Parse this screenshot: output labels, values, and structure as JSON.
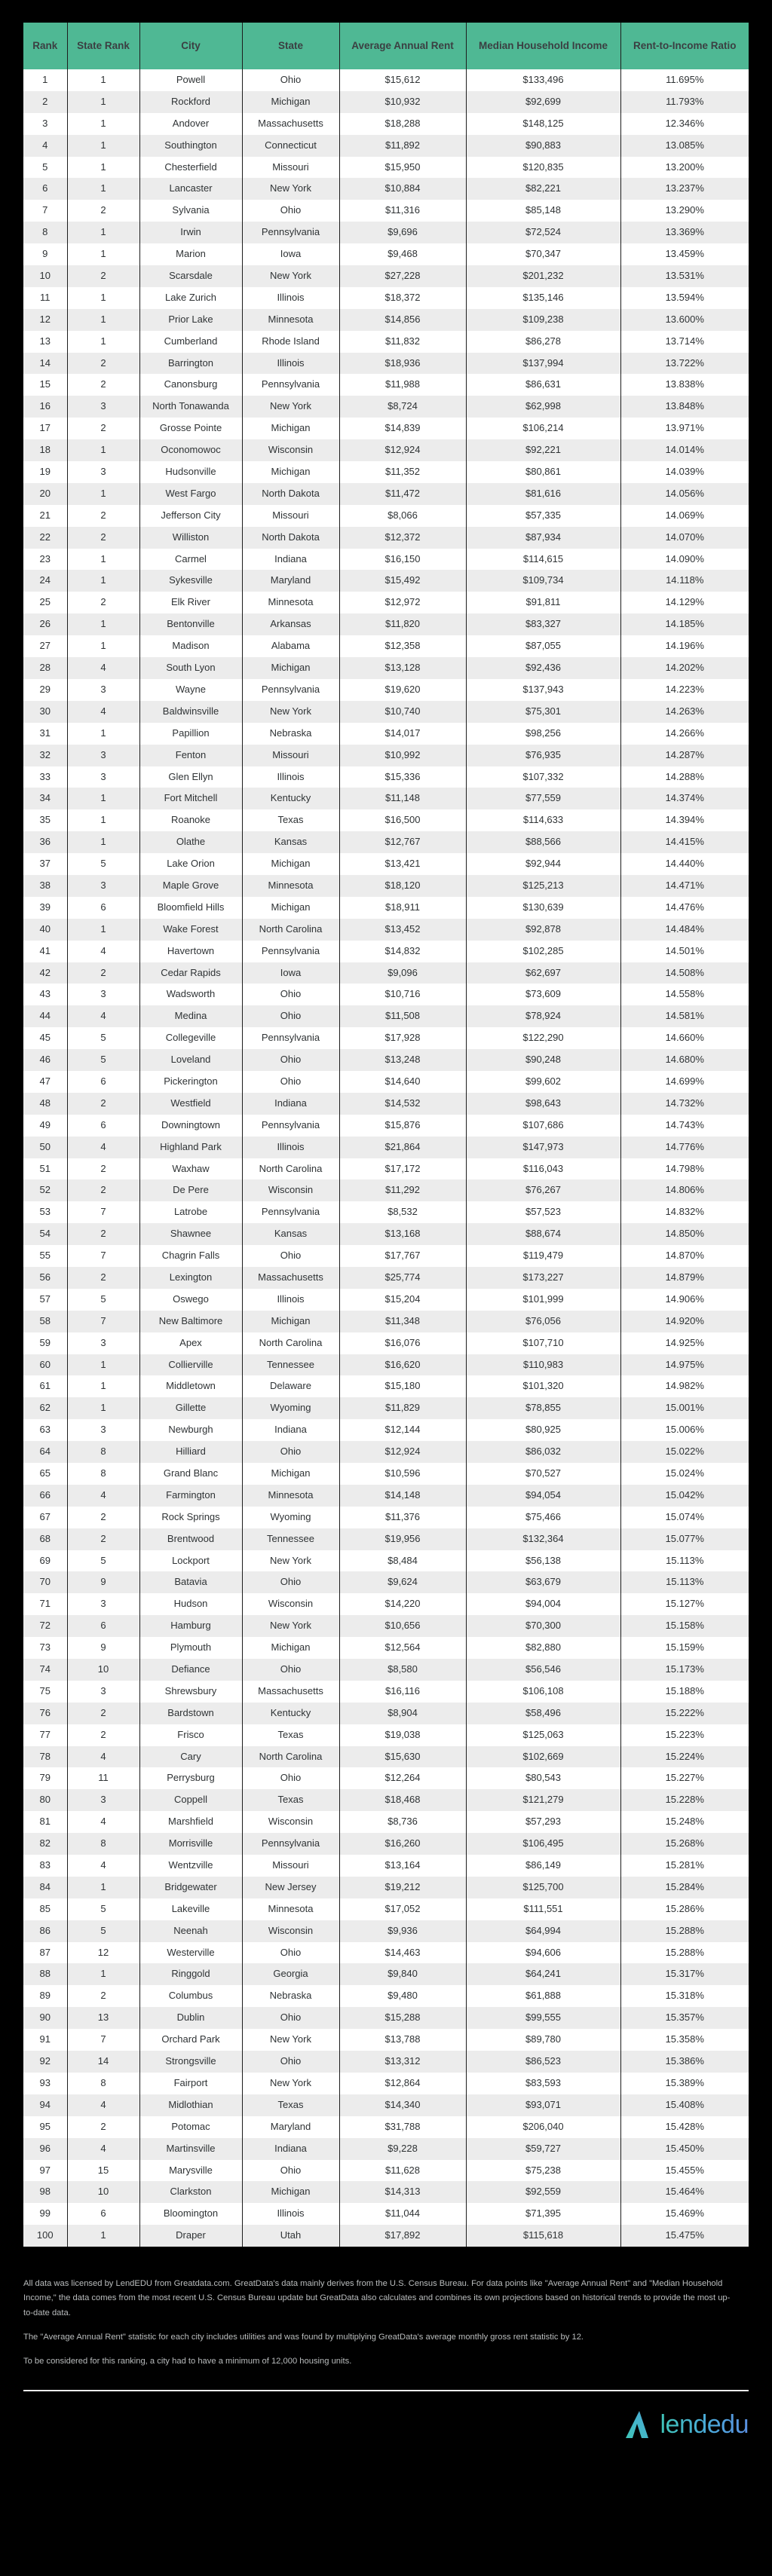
{
  "table": {
    "columns": [
      "Rank",
      "State Rank",
      "City",
      "State",
      "Average Annual Rent",
      "Median Household Income",
      "Rent-to-Income Ratio"
    ],
    "header_bg": "#4fb894",
    "rows": [
      [
        "1",
        "1",
        "Powell",
        "Ohio",
        "$15,612",
        "$133,496",
        "11.695%"
      ],
      [
        "2",
        "1",
        "Rockford",
        "Michigan",
        "$10,932",
        "$92,699",
        "11.793%"
      ],
      [
        "3",
        "1",
        "Andover",
        "Massachusetts",
        "$18,288",
        "$148,125",
        "12.346%"
      ],
      [
        "4",
        "1",
        "Southington",
        "Connecticut",
        "$11,892",
        "$90,883",
        "13.085%"
      ],
      [
        "5",
        "1",
        "Chesterfield",
        "Missouri",
        "$15,950",
        "$120,835",
        "13.200%"
      ],
      [
        "6",
        "1",
        "Lancaster",
        "New York",
        "$10,884",
        "$82,221",
        "13.237%"
      ],
      [
        "7",
        "2",
        "Sylvania",
        "Ohio",
        "$11,316",
        "$85,148",
        "13.290%"
      ],
      [
        "8",
        "1",
        "Irwin",
        "Pennsylvania",
        "$9,696",
        "$72,524",
        "13.369%"
      ],
      [
        "9",
        "1",
        "Marion",
        "Iowa",
        "$9,468",
        "$70,347",
        "13.459%"
      ],
      [
        "10",
        "2",
        "Scarsdale",
        "New York",
        "$27,228",
        "$201,232",
        "13.531%"
      ],
      [
        "11",
        "1",
        "Lake Zurich",
        "Illinois",
        "$18,372",
        "$135,146",
        "13.594%"
      ],
      [
        "12",
        "1",
        "Prior Lake",
        "Minnesota",
        "$14,856",
        "$109,238",
        "13.600%"
      ],
      [
        "13",
        "1",
        "Cumberland",
        "Rhode Island",
        "$11,832",
        "$86,278",
        "13.714%"
      ],
      [
        "14",
        "2",
        "Barrington",
        "Illinois",
        "$18,936",
        "$137,994",
        "13.722%"
      ],
      [
        "15",
        "2",
        "Canonsburg",
        "Pennsylvania",
        "$11,988",
        "$86,631",
        "13.838%"
      ],
      [
        "16",
        "3",
        "North Tonawanda",
        "New York",
        "$8,724",
        "$62,998",
        "13.848%"
      ],
      [
        "17",
        "2",
        "Grosse Pointe",
        "Michigan",
        "$14,839",
        "$106,214",
        "13.971%"
      ],
      [
        "18",
        "1",
        "Oconomowoc",
        "Wisconsin",
        "$12,924",
        "$92,221",
        "14.014%"
      ],
      [
        "19",
        "3",
        "Hudsonville",
        "Michigan",
        "$11,352",
        "$80,861",
        "14.039%"
      ],
      [
        "20",
        "1",
        "West Fargo",
        "North Dakota",
        "$11,472",
        "$81,616",
        "14.056%"
      ],
      [
        "21",
        "2",
        "Jefferson City",
        "Missouri",
        "$8,066",
        "$57,335",
        "14.069%"
      ],
      [
        "22",
        "2",
        "Williston",
        "North Dakota",
        "$12,372",
        "$87,934",
        "14.070%"
      ],
      [
        "23",
        "1",
        "Carmel",
        "Indiana",
        "$16,150",
        "$114,615",
        "14.090%"
      ],
      [
        "24",
        "1",
        "Sykesville",
        "Maryland",
        "$15,492",
        "$109,734",
        "14.118%"
      ],
      [
        "25",
        "2",
        "Elk River",
        "Minnesota",
        "$12,972",
        "$91,811",
        "14.129%"
      ],
      [
        "26",
        "1",
        "Bentonville",
        "Arkansas",
        "$11,820",
        "$83,327",
        "14.185%"
      ],
      [
        "27",
        "1",
        "Madison",
        "Alabama",
        "$12,358",
        "$87,055",
        "14.196%"
      ],
      [
        "28",
        "4",
        "South Lyon",
        "Michigan",
        "$13,128",
        "$92,436",
        "14.202%"
      ],
      [
        "29",
        "3",
        "Wayne",
        "Pennsylvania",
        "$19,620",
        "$137,943",
        "14.223%"
      ],
      [
        "30",
        "4",
        "Baldwinsville",
        "New York",
        "$10,740",
        "$75,301",
        "14.263%"
      ],
      [
        "31",
        "1",
        "Papillion",
        "Nebraska",
        "$14,017",
        "$98,256",
        "14.266%"
      ],
      [
        "32",
        "3",
        "Fenton",
        "Missouri",
        "$10,992",
        "$76,935",
        "14.287%"
      ],
      [
        "33",
        "3",
        "Glen Ellyn",
        "Illinois",
        "$15,336",
        "$107,332",
        "14.288%"
      ],
      [
        "34",
        "1",
        "Fort Mitchell",
        "Kentucky",
        "$11,148",
        "$77,559",
        "14.374%"
      ],
      [
        "35",
        "1",
        "Roanoke",
        "Texas",
        "$16,500",
        "$114,633",
        "14.394%"
      ],
      [
        "36",
        "1",
        "Olathe",
        "Kansas",
        "$12,767",
        "$88,566",
        "14.415%"
      ],
      [
        "37",
        "5",
        "Lake Orion",
        "Michigan",
        "$13,421",
        "$92,944",
        "14.440%"
      ],
      [
        "38",
        "3",
        "Maple Grove",
        "Minnesota",
        "$18,120",
        "$125,213",
        "14.471%"
      ],
      [
        "39",
        "6",
        "Bloomfield Hills",
        "Michigan",
        "$18,911",
        "$130,639",
        "14.476%"
      ],
      [
        "40",
        "1",
        "Wake Forest",
        "North Carolina",
        "$13,452",
        "$92,878",
        "14.484%"
      ],
      [
        "41",
        "4",
        "Havertown",
        "Pennsylvania",
        "$14,832",
        "$102,285",
        "14.501%"
      ],
      [
        "42",
        "2",
        "Cedar Rapids",
        "Iowa",
        "$9,096",
        "$62,697",
        "14.508%"
      ],
      [
        "43",
        "3",
        "Wadsworth",
        "Ohio",
        "$10,716",
        "$73,609",
        "14.558%"
      ],
      [
        "44",
        "4",
        "Medina",
        "Ohio",
        "$11,508",
        "$78,924",
        "14.581%"
      ],
      [
        "45",
        "5",
        "Collegeville",
        "Pennsylvania",
        "$17,928",
        "$122,290",
        "14.660%"
      ],
      [
        "46",
        "5",
        "Loveland",
        "Ohio",
        "$13,248",
        "$90,248",
        "14.680%"
      ],
      [
        "47",
        "6",
        "Pickerington",
        "Ohio",
        "$14,640",
        "$99,602",
        "14.699%"
      ],
      [
        "48",
        "2",
        "Westfield",
        "Indiana",
        "$14,532",
        "$98,643",
        "14.732%"
      ],
      [
        "49",
        "6",
        "Downingtown",
        "Pennsylvania",
        "$15,876",
        "$107,686",
        "14.743%"
      ],
      [
        "50",
        "4",
        "Highland Park",
        "Illinois",
        "$21,864",
        "$147,973",
        "14.776%"
      ],
      [
        "51",
        "2",
        "Waxhaw",
        "North Carolina",
        "$17,172",
        "$116,043",
        "14.798%"
      ],
      [
        "52",
        "2",
        "De Pere",
        "Wisconsin",
        "$11,292",
        "$76,267",
        "14.806%"
      ],
      [
        "53",
        "7",
        "Latrobe",
        "Pennsylvania",
        "$8,532",
        "$57,523",
        "14.832%"
      ],
      [
        "54",
        "2",
        "Shawnee",
        "Kansas",
        "$13,168",
        "$88,674",
        "14.850%"
      ],
      [
        "55",
        "7",
        "Chagrin Falls",
        "Ohio",
        "$17,767",
        "$119,479",
        "14.870%"
      ],
      [
        "56",
        "2",
        "Lexington",
        "Massachusetts",
        "$25,774",
        "$173,227",
        "14.879%"
      ],
      [
        "57",
        "5",
        "Oswego",
        "Illinois",
        "$15,204",
        "$101,999",
        "14.906%"
      ],
      [
        "58",
        "7",
        "New Baltimore",
        "Michigan",
        "$11,348",
        "$76,056",
        "14.920%"
      ],
      [
        "59",
        "3",
        "Apex",
        "North Carolina",
        "$16,076",
        "$107,710",
        "14.925%"
      ],
      [
        "60",
        "1",
        "Collierville",
        "Tennessee",
        "$16,620",
        "$110,983",
        "14.975%"
      ],
      [
        "61",
        "1",
        "Middletown",
        "Delaware",
        "$15,180",
        "$101,320",
        "14.982%"
      ],
      [
        "62",
        "1",
        "Gillette",
        "Wyoming",
        "$11,829",
        "$78,855",
        "15.001%"
      ],
      [
        "63",
        "3",
        "Newburgh",
        "Indiana",
        "$12,144",
        "$80,925",
        "15.006%"
      ],
      [
        "64",
        "8",
        "Hilliard",
        "Ohio",
        "$12,924",
        "$86,032",
        "15.022%"
      ],
      [
        "65",
        "8",
        "Grand Blanc",
        "Michigan",
        "$10,596",
        "$70,527",
        "15.024%"
      ],
      [
        "66",
        "4",
        "Farmington",
        "Minnesota",
        "$14,148",
        "$94,054",
        "15.042%"
      ],
      [
        "67",
        "2",
        "Rock Springs",
        "Wyoming",
        "$11,376",
        "$75,466",
        "15.074%"
      ],
      [
        "68",
        "2",
        "Brentwood",
        "Tennessee",
        "$19,956",
        "$132,364",
        "15.077%"
      ],
      [
        "69",
        "5",
        "Lockport",
        "New York",
        "$8,484",
        "$56,138",
        "15.113%"
      ],
      [
        "70",
        "9",
        "Batavia",
        "Ohio",
        "$9,624",
        "$63,679",
        "15.113%"
      ],
      [
        "71",
        "3",
        "Hudson",
        "Wisconsin",
        "$14,220",
        "$94,004",
        "15.127%"
      ],
      [
        "72",
        "6",
        "Hamburg",
        "New York",
        "$10,656",
        "$70,300",
        "15.158%"
      ],
      [
        "73",
        "9",
        "Plymouth",
        "Michigan",
        "$12,564",
        "$82,880",
        "15.159%"
      ],
      [
        "74",
        "10",
        "Defiance",
        "Ohio",
        "$8,580",
        "$56,546",
        "15.173%"
      ],
      [
        "75",
        "3",
        "Shrewsbury",
        "Massachusetts",
        "$16,116",
        "$106,108",
        "15.188%"
      ],
      [
        "76",
        "2",
        "Bardstown",
        "Kentucky",
        "$8,904",
        "$58,496",
        "15.222%"
      ],
      [
        "77",
        "2",
        "Frisco",
        "Texas",
        "$19,038",
        "$125,063",
        "15.223%"
      ],
      [
        "78",
        "4",
        "Cary",
        "North Carolina",
        "$15,630",
        "$102,669",
        "15.224%"
      ],
      [
        "79",
        "11",
        "Perrysburg",
        "Ohio",
        "$12,264",
        "$80,543",
        "15.227%"
      ],
      [
        "80",
        "3",
        "Coppell",
        "Texas",
        "$18,468",
        "$121,279",
        "15.228%"
      ],
      [
        "81",
        "4",
        "Marshfield",
        "Wisconsin",
        "$8,736",
        "$57,293",
        "15.248%"
      ],
      [
        "82",
        "8",
        "Morrisville",
        "Pennsylvania",
        "$16,260",
        "$106,495",
        "15.268%"
      ],
      [
        "83",
        "4",
        "Wentzville",
        "Missouri",
        "$13,164",
        "$86,149",
        "15.281%"
      ],
      [
        "84",
        "1",
        "Bridgewater",
        "New Jersey",
        "$19,212",
        "$125,700",
        "15.284%"
      ],
      [
        "85",
        "5",
        "Lakeville",
        "Minnesota",
        "$17,052",
        "$111,551",
        "15.286%"
      ],
      [
        "86",
        "5",
        "Neenah",
        "Wisconsin",
        "$9,936",
        "$64,994",
        "15.288%"
      ],
      [
        "87",
        "12",
        "Westerville",
        "Ohio",
        "$14,463",
        "$94,606",
        "15.288%"
      ],
      [
        "88",
        "1",
        "Ringgold",
        "Georgia",
        "$9,840",
        "$64,241",
        "15.317%"
      ],
      [
        "89",
        "2",
        "Columbus",
        "Nebraska",
        "$9,480",
        "$61,888",
        "15.318%"
      ],
      [
        "90",
        "13",
        "Dublin",
        "Ohio",
        "$15,288",
        "$99,555",
        "15.357%"
      ],
      [
        "91",
        "7",
        "Orchard Park",
        "New York",
        "$13,788",
        "$89,780",
        "15.358%"
      ],
      [
        "92",
        "14",
        "Strongsville",
        "Ohio",
        "$13,312",
        "$86,523",
        "15.386%"
      ],
      [
        "93",
        "8",
        "Fairport",
        "New York",
        "$12,864",
        "$83,593",
        "15.389%"
      ],
      [
        "94",
        "4",
        "Midlothian",
        "Texas",
        "$14,340",
        "$93,071",
        "15.408%"
      ],
      [
        "95",
        "2",
        "Potomac",
        "Maryland",
        "$31,788",
        "$206,040",
        "15.428%"
      ],
      [
        "96",
        "4",
        "Martinsville",
        "Indiana",
        "$9,228",
        "$59,727",
        "15.450%"
      ],
      [
        "97",
        "15",
        "Marysville",
        "Ohio",
        "$11,628",
        "$75,238",
        "15.455%"
      ],
      [
        "98",
        "10",
        "Clarkston",
        "Michigan",
        "$14,313",
        "$92,559",
        "15.464%"
      ],
      [
        "99",
        "6",
        "Bloomington",
        "Illinois",
        "$11,044",
        "$71,395",
        "15.469%"
      ],
      [
        "100",
        "1",
        "Draper",
        "Utah",
        "$17,892",
        "$115,618",
        "15.475%"
      ]
    ]
  },
  "footnotes": [
    "All data was licensed by LendEDU from Greatdata.com. GreatData's data mainly derives from the U.S. Census Bureau. For data points like \"Average Annual Rent\" and \"Median Household Income,\" the data comes from the most recent U.S. Census Bureau update but GreatData also calculates and combines its own projections based on historical trends to provide the most up-to-date data.",
    "The \"Average Annual Rent\" statistic for each city includes utilities and was found by multiplying GreatData's average monthly gross rent statistic by 12.",
    "To be considered for this ranking, a city had to have a minimum of 12,000 housing units."
  ],
  "brand": {
    "name": "lendedu"
  }
}
